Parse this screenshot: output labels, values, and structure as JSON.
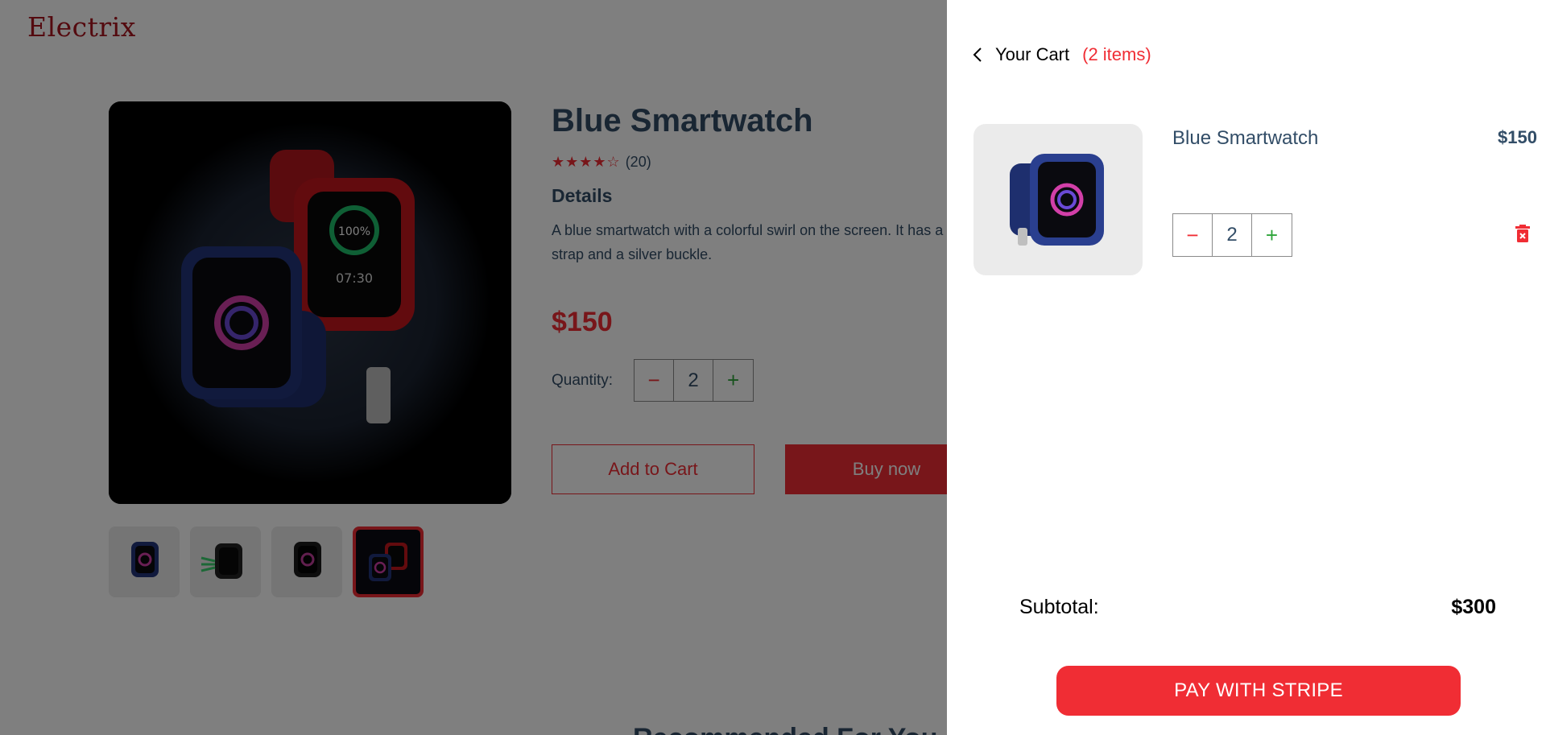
{
  "brand": {
    "logo": "Electrix",
    "accent_color": "#f02d34"
  },
  "product": {
    "title": "Blue Smartwatch",
    "stars_display": "★★★★☆",
    "review_count": "(20)",
    "details_heading": "Details",
    "description": "A blue smartwatch with a colorful swirl on the screen. It has a blue strap and a silver buckle.",
    "price": "$150",
    "quantity_label": "Quantity:",
    "quantity": "2",
    "minus_symbol": "−",
    "plus_symbol": "+",
    "add_to_cart_label": "Add to Cart",
    "buy_now_label": "Buy now",
    "thumbnails": [
      "blue-watch",
      "green-watch",
      "black-watch",
      "red-blue-watch"
    ],
    "rating": 4
  },
  "recommended": {
    "title": "Recommended For You"
  },
  "cart": {
    "heading": "Your Cart",
    "item_count": "(2 items)",
    "items": [
      {
        "name": "Blue Smartwatch",
        "price": "$150",
        "quantity": "2"
      }
    ],
    "subtotal_label": "Subtotal:",
    "subtotal_value": "$300",
    "pay_label": "PAY WITH STRIPE",
    "icons": [
      "chevron-left-icon",
      "trash-icon"
    ]
  }
}
